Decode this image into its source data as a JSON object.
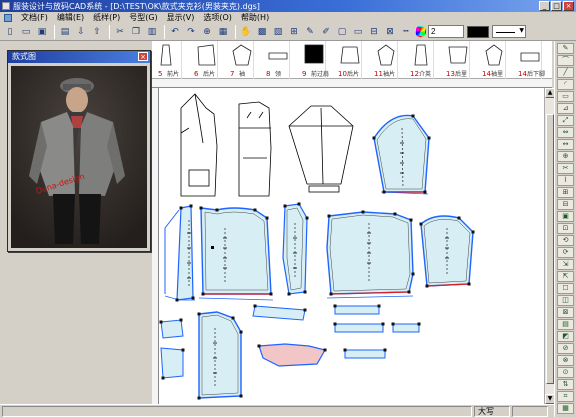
{
  "window": {
    "title": "服装设计与放码CAD系统 - [D:\\TEST\\OK\\款式夹克衫(男装夹克).dgs]",
    "minimize_label": "_",
    "maximize_label": "□",
    "close_label": "×"
  },
  "menu": {
    "items": [
      "文档(F)",
      "编辑(E)",
      "纸样(P)",
      "号型(G)",
      "显示(V)",
      "选项(O)",
      "帮助(H)"
    ]
  },
  "toolbar": {
    "icons": [
      "new-file-icon",
      "open-folder-icon",
      "save-icon",
      "print-icon",
      "import-icon",
      "export-icon",
      "cut-icon",
      "copy-icon",
      "paste-icon",
      "undo-icon",
      "redo-icon",
      "zoom-icon",
      "table-icon",
      "color-wheel-icon"
    ],
    "line_width_value": "2",
    "color_value": "#000000"
  },
  "piece_strip": {
    "pieces": [
      {
        "label": "5",
        "name": "前片"
      },
      {
        "label": "6",
        "name": "后片"
      },
      {
        "label": "7",
        "name": "袖"
      },
      {
        "label": "8",
        "name": "领"
      },
      {
        "label": "9",
        "name": "前过肩"
      },
      {
        "label": "10",
        "name": "后片"
      },
      {
        "label": "11",
        "name": "袖片"
      },
      {
        "label": "12",
        "name": "介英"
      },
      {
        "label": "13",
        "name": "后里"
      },
      {
        "label": "14",
        "name": "袖里"
      },
      {
        "label": "14",
        "name": "后下脚"
      }
    ]
  },
  "ruler": {
    "ticks": [
      "",
      "",
      "",
      "",
      "",
      "",
      "",
      "",
      "",
      "",
      "",
      "",
      "",
      "",
      "",
      "",
      ""
    ]
  },
  "sketch_window": {
    "title": "款式图",
    "close_label": "×",
    "photo_text": "Duna-design"
  },
  "status": {
    "mode": "",
    "zoom": "大写",
    "extra": ""
  },
  "colors": {
    "piece_fill": "#d6eef4",
    "piece_fill_pink": "#f2c6c6",
    "grade_blue": "#1e64ff",
    "grade_red": "#e02020",
    "titlebar": "#1f3f9f"
  }
}
